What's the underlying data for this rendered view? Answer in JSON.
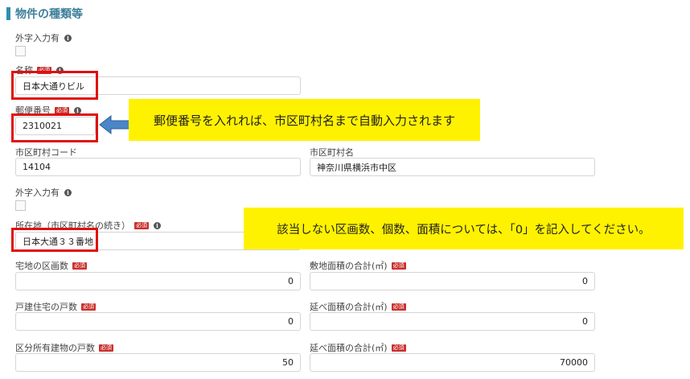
{
  "section": {
    "title": "物件の種類等"
  },
  "fields": {
    "gaiji1_label": "外字入力有",
    "name_label": "名称",
    "name_value": "日本大通りビル",
    "postal_label": "郵便番号",
    "postal_value": "2310021",
    "city_code_label": "市区町村コード",
    "city_code_value": "14104",
    "city_name_label": "市区町村名",
    "city_name_value": "神奈川県横浜市中区",
    "gaiji2_label": "外字入力有",
    "address_label": "所在地（市区町村名の続き）",
    "address_value": "日本大通３３番地",
    "lots_label": "宅地の区画数",
    "lots_value": "0",
    "site_area_label": "敷地面積の合計(㎡)",
    "site_area_value": "0",
    "houses_label": "戸建住宅の戸数",
    "houses_value": "0",
    "floor_area1_label": "延べ面積の合計(㎡)",
    "floor_area1_value": "0",
    "units_label": "区分所有建物の戸数",
    "units_value": "50",
    "floor_area2_label": "延べ面積の合計(㎡)",
    "floor_area2_value": "70000"
  },
  "badges": {
    "required": "必須",
    "info": "i"
  },
  "callouts": {
    "postal_note": "郵便番号を入れれば、市区町村名まで自動入力されます",
    "zero_note": "該当しない区画数、個数、面積については、「0」を記入してください。"
  },
  "colors": {
    "accent": "#2f8fae",
    "required_badge": "#c9302c",
    "highlight": "#e01010",
    "callout_bg": "#fff200",
    "arrow": "#4a86c8"
  }
}
